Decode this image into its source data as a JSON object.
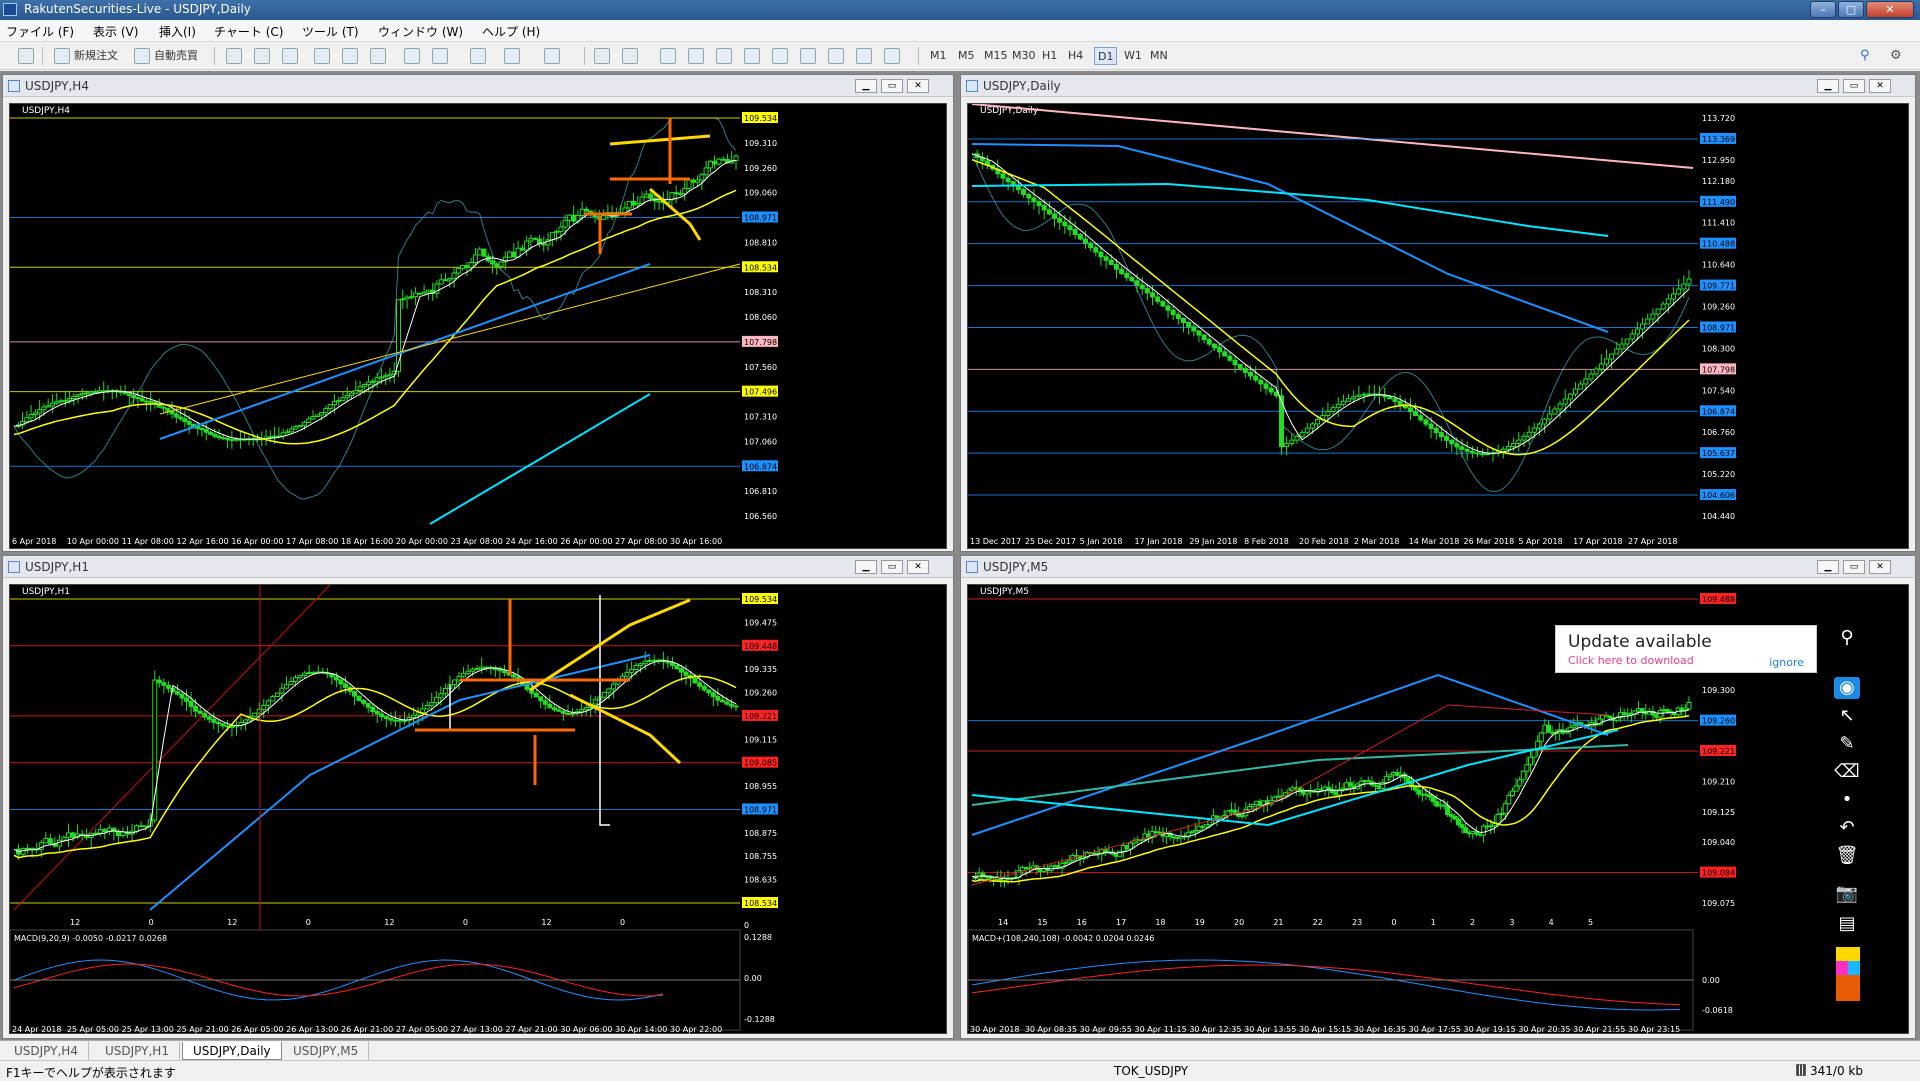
{
  "window": {
    "title": "RakutenSecurities-Live - USDJPY,Daily",
    "title_redacted": "        "
  },
  "menu": [
    "ファイル (F)",
    "表示 (V)",
    "挿入(I)",
    "チャート (C)",
    "ツール (T)",
    "ウィンドウ (W)",
    "ヘルプ (H)"
  ],
  "toolbar": {
    "new_order": "新規注文",
    "auto_trade": "自動売買",
    "timeframes": [
      "M1",
      "M5",
      "M15",
      "M30",
      "H1",
      "H4",
      "D1",
      "W1",
      "MN"
    ]
  },
  "charts": {
    "h4": {
      "title": "USDJPY,H4",
      "label": "USDJPY,H4",
      "y_labels": [
        "109.534",
        "109.310",
        "109.260",
        "109.060",
        "108.971",
        "108.810",
        "108.534",
        "108.310",
        "108.060",
        "107.798",
        "107.560",
        "107.496",
        "107.310",
        "107.060",
        "106.874",
        "106.810",
        "106.560"
      ],
      "x_labels": [
        "6 Apr 2018",
        "10 Apr 00:00",
        "11 Apr 08:00",
        "12 Apr 16:00",
        "16 Apr 00:00",
        "17 Apr 08:00",
        "18 Apr 16:00",
        "20 Apr 00:00",
        "23 Apr 08:00",
        "24 Apr 16:00",
        "26 Apr 00:00",
        "27 Apr 08:00",
        "30 Apr 16:00"
      ]
    },
    "daily": {
      "title": "USDJPY,Daily",
      "label": "USDJPY,Daily",
      "y_labels": [
        "113.720",
        "113.369",
        "112.950",
        "112.180",
        "111.490",
        "111.410",
        "110.488",
        "110.640",
        "109.771",
        "109.260",
        "108.971",
        "108.300",
        "107.798",
        "107.540",
        "106.874",
        "106.760",
        "105.637",
        "105.220",
        "104.606",
        "104.440"
      ],
      "x_labels": [
        "13 Dec 2017",
        "25 Dec 2017",
        "5 Jan 2018",
        "17 Jan 2018",
        "29 Jan 2018",
        "8 Feb 2018",
        "20 Feb 2018",
        "2 Mar 2018",
        "14 Mar 2018",
        "26 Mar 2018",
        "5 Apr 2018",
        "17 Apr 2018",
        "27 Apr 2018"
      ]
    },
    "h1": {
      "title": "USDJPY,H1",
      "label": "USDJPY,H1",
      "y_labels": [
        "109.534",
        "109.475",
        "109.448",
        "109.335",
        "109.260",
        "109.221",
        "109.115",
        "109.085",
        "108.955",
        "108.971",
        "108.875",
        "108.755",
        "108.635",
        "108.534"
      ],
      "x_labels": [
        "12",
        "0",
        "12",
        "0",
        "12",
        "0",
        "12",
        "0"
      ],
      "macd": {
        "label": "MACD(9,20,9) -0.0050 -0.0217 0.0268",
        "y_labels": [
          "0.1288",
          "0.00",
          "-0.1288"
        ],
        "zero_ref": "0"
      },
      "x_bottom": [
        "24 Apr 2018",
        "25 Apr 05:00",
        "25 Apr 13:00",
        "25 Apr 21:00",
        "26 Apr 05:00",
        "26 Apr 13:00",
        "26 Apr 21:00",
        "27 Apr 05:00",
        "27 Apr 13:00",
        "27 Apr 21:00",
        "30 Apr 06:00",
        "30 Apr 14:00",
        "30 Apr 22:00"
      ]
    },
    "m5": {
      "title": "USDJPY,M5",
      "label": "USDJPY,M5",
      "y_labels": [
        "109.488",
        "109.435",
        "109.345",
        "109.300",
        "109.260",
        "109.221",
        "109.210",
        "109.125",
        "109.040",
        "109.084",
        "109.075"
      ],
      "x_labels": [
        "14",
        "15",
        "16",
        "17",
        "18",
        "19",
        "20",
        "21",
        "22",
        "23",
        "0",
        "1",
        "2",
        "3",
        "4",
        "5"
      ],
      "macd": {
        "label": "MACD+(108,240,108) -0.0042 0.0204 0.0246",
        "y_labels": [
          "0.00",
          "-0.0618"
        ]
      },
      "x_bottom": [
        "30 Apr 2018",
        "30 Apr 08:35",
        "30 Apr 09:55",
        "30 Apr 11:15",
        "30 Apr 12:35",
        "30 Apr 13:55",
        "30 Apr 15:15",
        "30 Apr 16:35",
        "30 Apr 17:55",
        "30 Apr 19:15",
        "30 Apr 20:35",
        "30 Apr 21:55",
        "30 Apr 23:15"
      ]
    }
  },
  "popup": {
    "heading": "Update available",
    "link": "Click here to download",
    "ignore": "ignore"
  },
  "tabs": [
    "USDJPY,H4",
    "USDJPY,H1",
    "USDJPY,Daily",
    "USDJPY,M5"
  ],
  "status": {
    "help": "F1キーでヘルプが表示されます",
    "profile": "TOK_USDJPY",
    "traffic": "341/0 kb"
  },
  "colors": {
    "yellow_ma": "#ffff00",
    "white_ma": "#ffffff",
    "blue_ma": "#1e90ff",
    "cyan_ma": "#00e5ff",
    "candle": "#22dd22",
    "drawing_yellow": "#ffd800",
    "drawing_orange": "#ff6a00",
    "pink": "#ffb6c1"
  }
}
